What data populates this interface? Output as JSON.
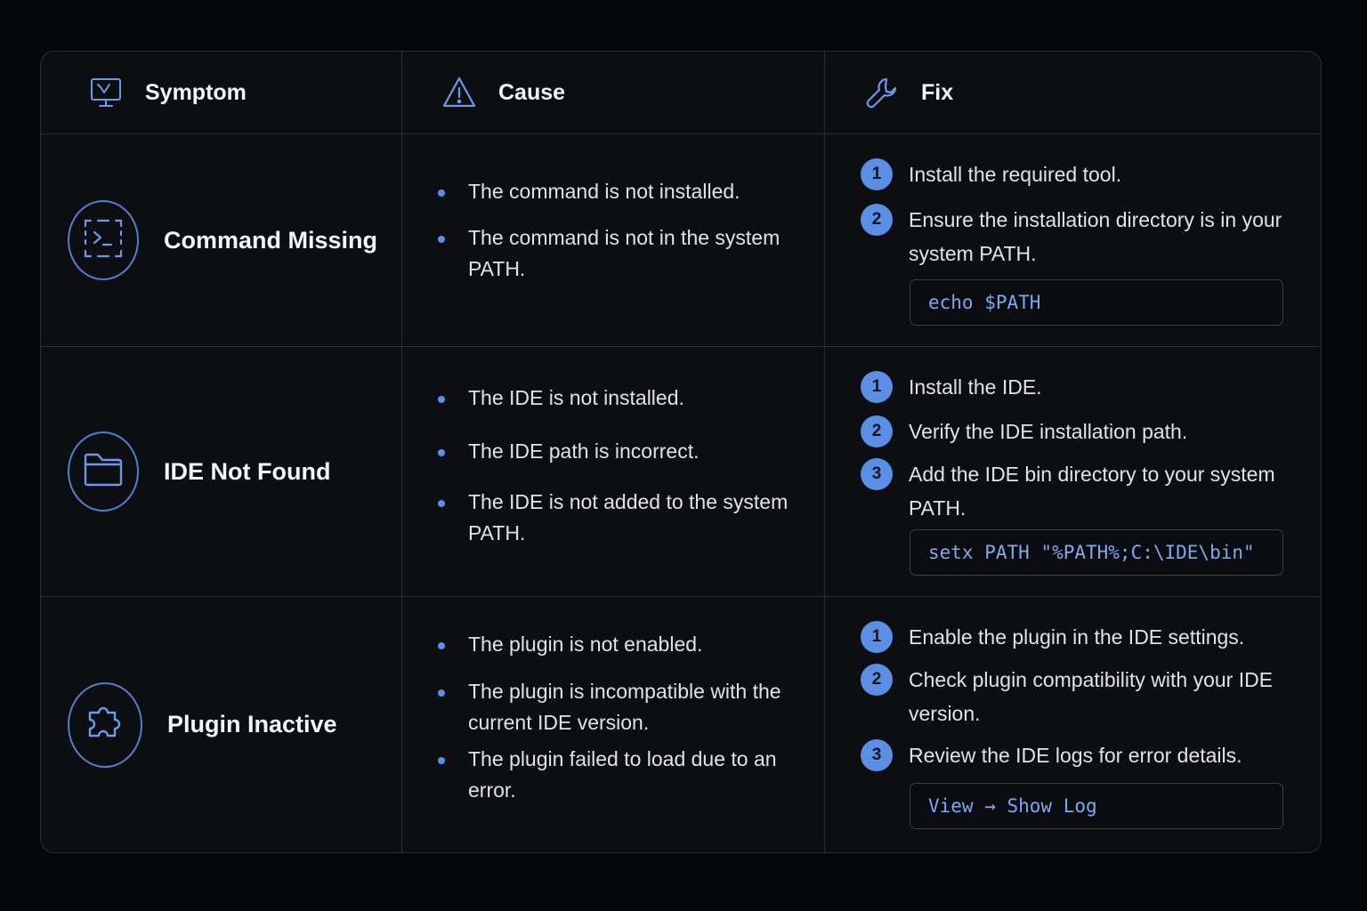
{
  "header": {
    "symptom": "Symptom",
    "cause": "Cause",
    "fix": "Fix"
  },
  "rows": [
    {
      "symptom": "Command Missing",
      "icon": "terminal-icon",
      "causes": [
        "The command is not installed.",
        "The command is not in the system PATH."
      ],
      "steps": [
        {
          "num": "1",
          "text": "Install the required tool."
        },
        {
          "num": "2",
          "text": "Ensure the installation directory is in your system PATH."
        }
      ],
      "code": "echo $PATH"
    },
    {
      "symptom": "IDE Not Found",
      "icon": "folder-icon",
      "causes": [
        "The IDE is not installed.",
        "The IDE path is incorrect.",
        "The IDE is not added to the system PATH."
      ],
      "steps": [
        {
          "num": "1",
          "text": "Install the IDE."
        },
        {
          "num": "2",
          "text": "Verify the IDE installation path."
        },
        {
          "num": "3",
          "text": "Add the IDE bin directory to your system PATH."
        }
      ],
      "code": "setx PATH \"%PATH%;C:\\IDE\\bin\""
    },
    {
      "symptom": "Plugin Inactive",
      "icon": "puzzle-icon",
      "causes": [
        "The plugin is not enabled.",
        "The plugin is incompatible with the current IDE version.",
        "The plugin failed to load due to an error."
      ],
      "steps": [
        {
          "num": "1",
          "text": "Enable the plugin in the IDE settings."
        },
        {
          "num": "2",
          "text": "Check plugin compatibility with your IDE version."
        },
        {
          "num": "3",
          "text": "Review the IDE logs for error details."
        }
      ],
      "code": "View → Show Log"
    }
  ],
  "colors": {
    "accent": "#5a8fe3",
    "background": "#0c0e12",
    "border": "#2a2e35"
  }
}
